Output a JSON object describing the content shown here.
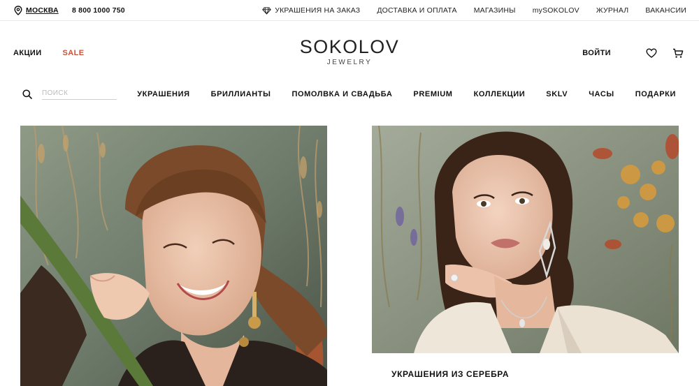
{
  "topbar": {
    "city": "МОСКВА",
    "phone": "8 800 1000 750",
    "links": [
      "УКРАШЕНИЯ НА ЗАКАЗ",
      "ДОСТАВКА И ОПЛАТА",
      "МАГАЗИНЫ",
      "mySOKOLOV",
      "ЖУРНАЛ",
      "ВАКАНСИИ"
    ]
  },
  "header": {
    "promo_actions": "АКЦИИ",
    "promo_sale": "SALE",
    "brand": "SOKOLOV",
    "brand_sub": "JEWELRY",
    "login": "ВОЙТИ"
  },
  "search": {
    "placeholder": "ПОИСК"
  },
  "nav": {
    "items": [
      "УКРАШЕНИЯ",
      "БРИЛЛИАНТЫ",
      "ПОМОЛВКА И СВАДЬБА",
      "PREMIUM",
      "КОЛЛЕКЦИИ",
      "SKLV",
      "ЧАСЫ",
      "ПОДАРКИ"
    ]
  },
  "cards": {
    "right_caption": "УКРАШЕНИЯ ИЗ СЕРЕБРА"
  },
  "colors": {
    "accent_sale": "#c9513c",
    "text": "#111111"
  },
  "icons": [
    "location-pin-icon",
    "diamond-icon",
    "heart-icon",
    "cart-icon",
    "search-icon"
  ]
}
